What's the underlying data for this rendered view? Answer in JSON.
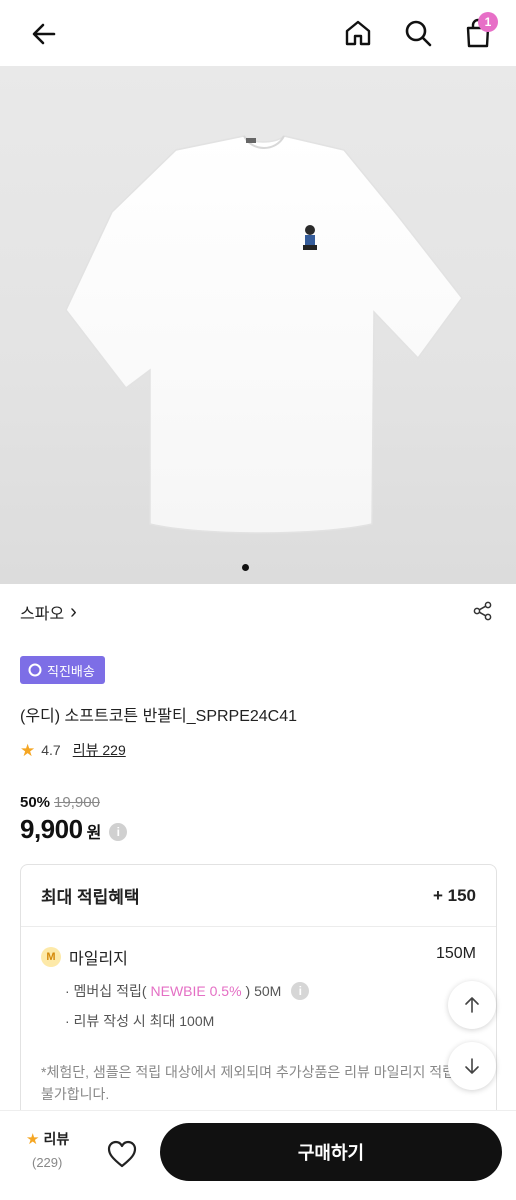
{
  "header": {
    "cart_count": "1",
    "icons": [
      "back-arrow-icon",
      "home-icon",
      "search-icon",
      "shopping-bag-icon"
    ]
  },
  "gallery": {
    "image_alt": "white t-shirt",
    "pager_dots": 1
  },
  "brand": {
    "name": "스파오",
    "chevron": "›"
  },
  "delivery_badge": "직진배송",
  "product": {
    "title": "(우디) 소프트코튼 반팔티_SPRPE24C41",
    "rating": "4.7",
    "review_label": "리뷰 229",
    "discount": "50%",
    "original_price": "19,900",
    "price": "9,900",
    "currency": "원"
  },
  "points": {
    "header_label": "최대 적립혜택",
    "header_value": "+ 150",
    "mileage_label": "마일리지",
    "mileage_value": "150M",
    "mileage_icon": "M",
    "membership_prefix": "· 멤버십 적립(",
    "membership_tier": "NEWBIE 0.5%",
    "membership_suffix": ") 50M",
    "review_bonus": "· 리뷰 작성 시 최대 100M",
    "note": "*체험단, 샘플은 적립 대상에서 제외되며 추가상품은 리뷰 마일리지 적립이 불가합니다."
  },
  "bottom_bar": {
    "review_label": "리뷰",
    "review_count": "(229)",
    "buy_label": "구매하기"
  },
  "colors": {
    "badge_purple": "#7d6ee6",
    "cart_badge_pink": "#e76fc7",
    "star": "#f5a623",
    "buy_button": "#111111"
  }
}
